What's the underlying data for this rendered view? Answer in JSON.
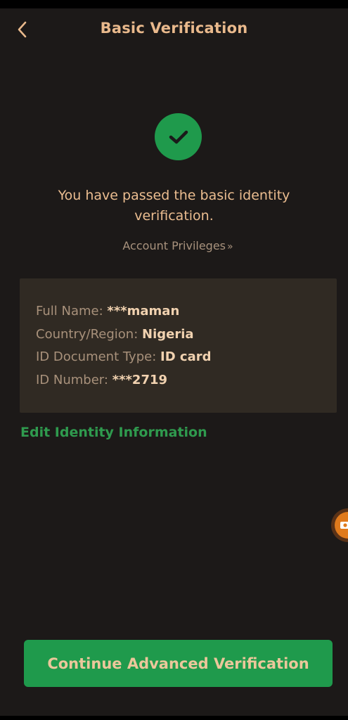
{
  "header": {
    "title": "Basic Verification",
    "back_icon": "chevron-left-icon"
  },
  "status": {
    "icon": "check-circle-icon",
    "message": "You have passed the basic identity verification.",
    "privileges_label": "Account Privileges",
    "privileges_arrow": "»"
  },
  "identity": {
    "full_name": {
      "label": "Full Name:",
      "value": "***maman"
    },
    "country": {
      "label": "Country/Region:",
      "value": "Nigeria"
    },
    "doc_type": {
      "label": "ID Document Type:",
      "value": "ID card"
    },
    "id_number": {
      "label": "ID Number:",
      "value": "***2719"
    }
  },
  "edit_link": "Edit Identity Information",
  "cta_label": "Continue Advanced Verification",
  "floating_widget_icon": "camera-icon",
  "colors": {
    "background": "#1c1918",
    "accent_text": "#e9b98c",
    "success_green": "#1f9a4c",
    "card_background": "#302a23"
  }
}
